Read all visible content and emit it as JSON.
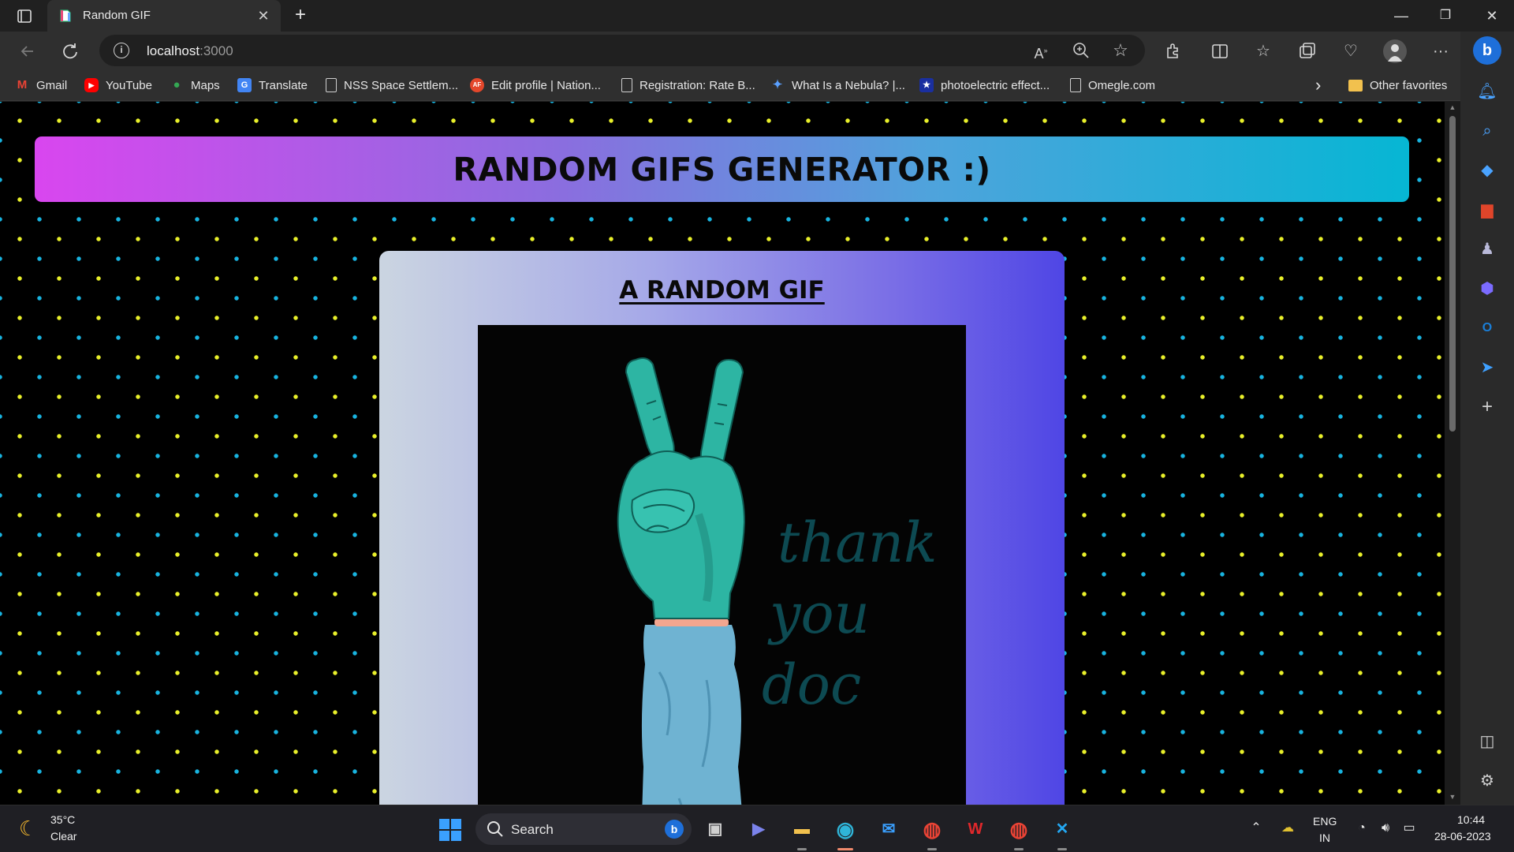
{
  "browser": {
    "tab_title": "Random GIF",
    "tab_close": "✕",
    "new_tab": "+",
    "url_host": "localhost",
    "url_port": ":3000",
    "window": {
      "minimize": "—",
      "restore": "❐",
      "close": "✕"
    }
  },
  "favorites": {
    "items": [
      {
        "label": "Gmail",
        "icon": "gmail-icon",
        "glyph": "M"
      },
      {
        "label": "YouTube",
        "icon": "youtube-icon",
        "glyph": "▶"
      },
      {
        "label": "Maps",
        "icon": "maps-icon",
        "glyph": "●"
      },
      {
        "label": "Translate",
        "icon": "translate-icon",
        "glyph": "G"
      },
      {
        "label": "NSS Space Settlem...",
        "icon": "page-icon",
        "glyph": ""
      },
      {
        "label": "Edit profile | Nation...",
        "icon": "af-icon",
        "glyph": "AF"
      },
      {
        "label": "Registration: Rate B...",
        "icon": "page-icon",
        "glyph": ""
      },
      {
        "label": "What Is a Nebula? |...",
        "icon": "nasa-icon",
        "glyph": "✦"
      },
      {
        "label": "photoelectric effect...",
        "icon": "star-site-icon",
        "glyph": "★"
      },
      {
        "label": "Omegle.com",
        "icon": "page-icon",
        "glyph": ""
      }
    ],
    "overflow": "›",
    "other_favorites": "Other favorites"
  },
  "page": {
    "header_title": "RANDOM GIFS GENERATOR :)",
    "card_title": "A RANDOM GIF",
    "gif_text": [
      "thank",
      "you",
      "doc"
    ],
    "colors": {
      "header_from": "#d946ef",
      "header_to": "#06b6d4",
      "card_from": "#cbd5e1",
      "card_to": "#4f46e5",
      "dot_yellow": "#e9f02a",
      "dot_blue": "#18b4e0",
      "hand": "#2db5a3",
      "sleeve": "#6fb3d2"
    }
  },
  "taskbar": {
    "temperature": "35°C",
    "weather": "Clear",
    "search_label": "Search",
    "lang_top": "ENG",
    "lang_bottom": "IN",
    "time": "10:44",
    "date": "28-06-2023"
  }
}
